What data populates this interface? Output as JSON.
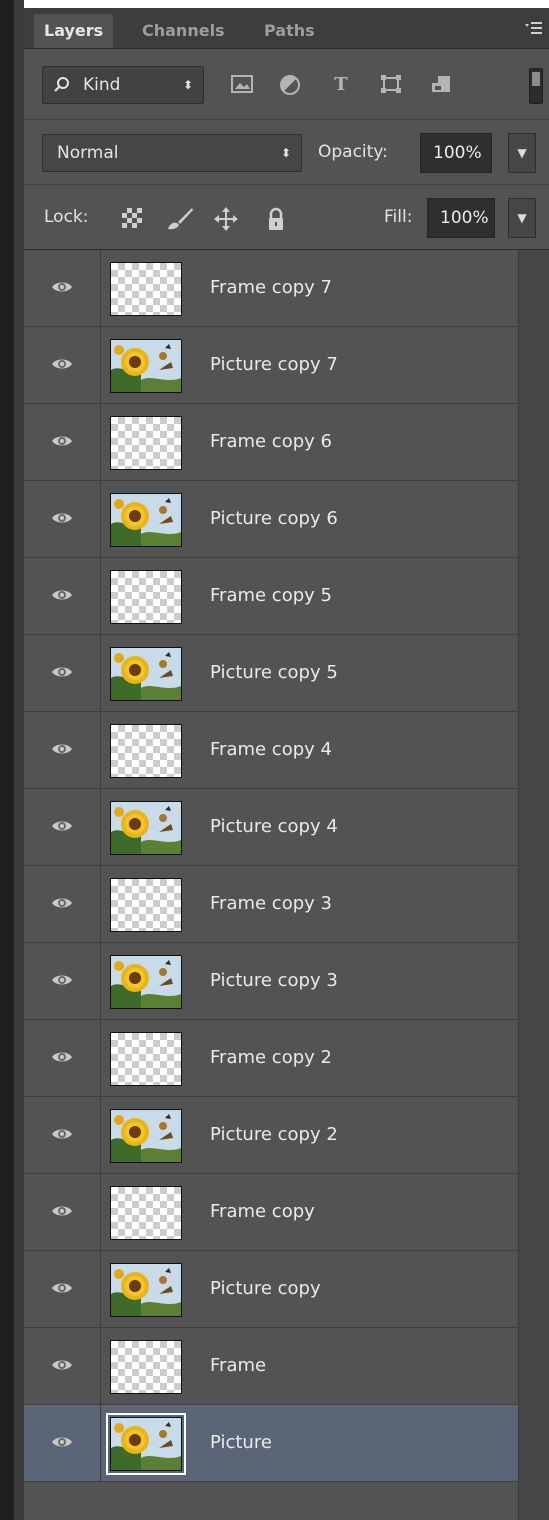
{
  "tabs": [
    {
      "label": "Layers",
      "active": true
    },
    {
      "label": "Channels",
      "active": false
    },
    {
      "label": "Paths",
      "active": false
    }
  ],
  "filter": {
    "kind_label": "Kind",
    "icons": [
      "image-filter-icon",
      "adjustment-filter-icon",
      "type-filter-icon",
      "shape-filter-icon",
      "smart-object-filter-icon"
    ]
  },
  "blend": {
    "mode": "Normal",
    "opacity_label": "Opacity:",
    "opacity_value": "100%"
  },
  "lock": {
    "label": "Lock:",
    "icons": [
      "lock-transparent-pixels-icon",
      "lock-image-pixels-icon",
      "lock-position-icon",
      "lock-all-icon"
    ],
    "fill_label": "Fill:",
    "fill_value": "100%"
  },
  "layers": [
    {
      "name": "Frame copy 7",
      "thumb": "frame",
      "visible": true
    },
    {
      "name": "Picture copy 7",
      "thumb": "picture",
      "visible": true
    },
    {
      "name": "Frame copy 6",
      "thumb": "frame",
      "visible": true
    },
    {
      "name": "Picture copy 6",
      "thumb": "picture",
      "visible": true
    },
    {
      "name": "Frame copy 5",
      "thumb": "frame",
      "visible": true
    },
    {
      "name": "Picture copy 5",
      "thumb": "picture",
      "visible": true
    },
    {
      "name": "Frame copy 4",
      "thumb": "frame",
      "visible": true
    },
    {
      "name": "Picture copy 4",
      "thumb": "picture",
      "visible": true
    },
    {
      "name": "Frame copy 3",
      "thumb": "frame",
      "visible": true
    },
    {
      "name": "Picture copy 3",
      "thumb": "picture",
      "visible": true
    },
    {
      "name": "Frame copy 2",
      "thumb": "frame",
      "visible": true
    },
    {
      "name": "Picture copy 2",
      "thumb": "picture",
      "visible": true
    },
    {
      "name": "Frame copy",
      "thumb": "frame",
      "visible": true
    },
    {
      "name": "Picture copy",
      "thumb": "picture",
      "visible": true
    },
    {
      "name": "Frame",
      "thumb": "frame",
      "visible": true
    },
    {
      "name": "Picture",
      "thumb": "picture",
      "visible": true,
      "selected": true
    }
  ],
  "colors": {
    "panel_bg": "#535353",
    "tabbar_bg": "#3d3d3d",
    "selected_row": "#5a6677",
    "text": "#eaeaea"
  }
}
